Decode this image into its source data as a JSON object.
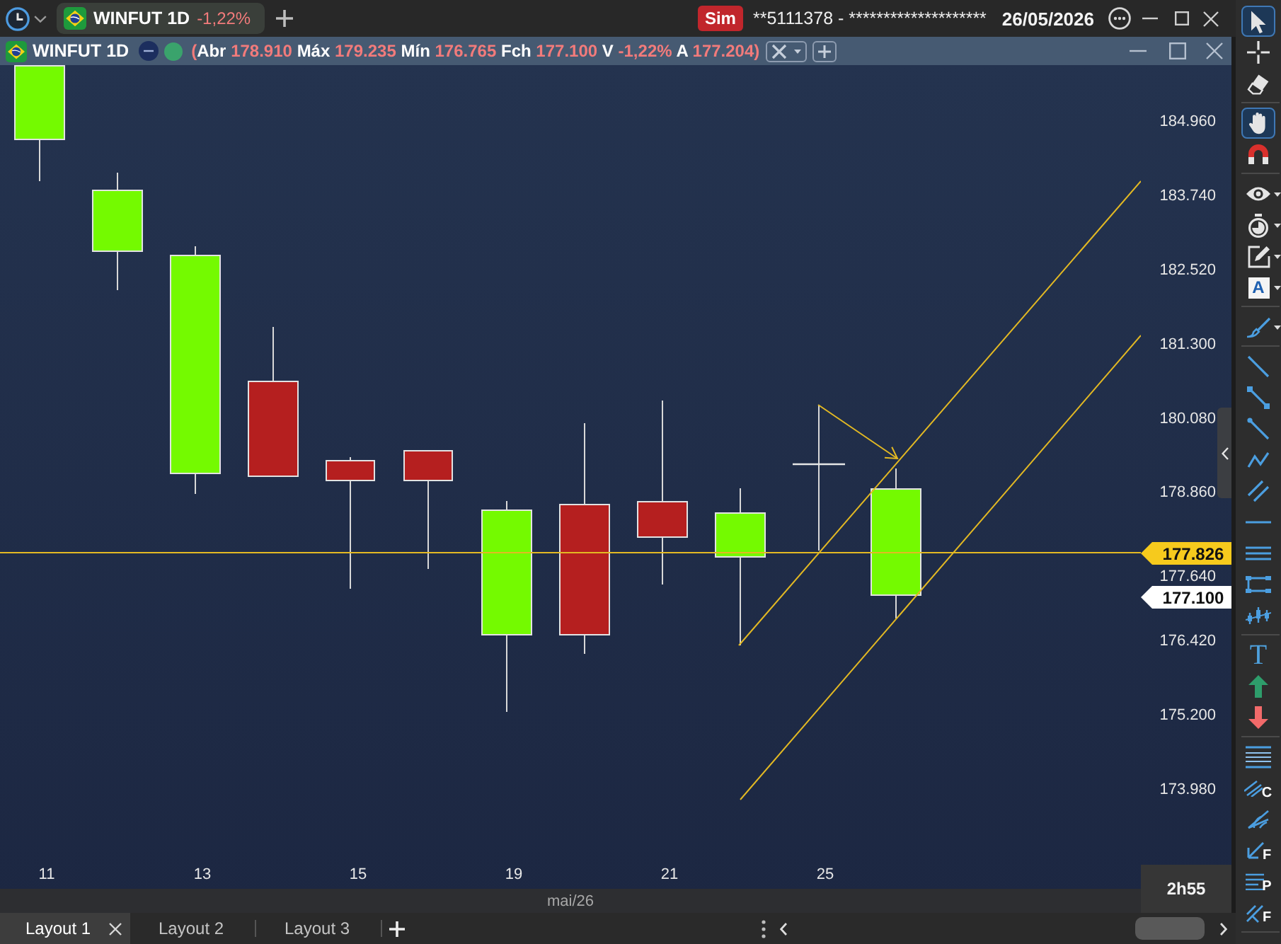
{
  "title_bar": {
    "tabs": [
      {
        "symbol": "WINFUT 1D",
        "change": "-1,22%",
        "selected": true
      }
    ],
    "mode_badge": "Sim",
    "account": "**5111378 - ********************",
    "date": "26/05/2026"
  },
  "chart": {
    "header": {
      "symbol": "WINFUT 1D",
      "quote": {
        "open": "(",
        "fields": [
          {
            "label": "Abr",
            "value": "178.910"
          },
          {
            "label": "Máx",
            "value": "179.235"
          },
          {
            "label": "Mín",
            "value": "176.765"
          },
          {
            "label": "Fch",
            "value": "177.100"
          },
          {
            "label": "V",
            "value": "-1,22%"
          },
          {
            "label": "A",
            "value": "177.204"
          }
        ],
        "close": ")"
      }
    },
    "price_axis": {
      "ticks": [
        "184.960",
        "183.740",
        "182.520",
        "181.300",
        "180.080",
        "178.860",
        "177.640",
        "176.420",
        "175.200",
        "173.980"
      ],
      "current_price": "177.826",
      "last_close": "177.100"
    },
    "time_axis": {
      "ticks": [
        "11",
        "13",
        "15",
        "19",
        "21",
        "25"
      ],
      "month": "mai/26"
    },
    "countdown": "2h55"
  },
  "layout_tabs": [
    {
      "label": "Layout 1",
      "selected": true
    },
    {
      "label": "Layout 2",
      "selected": false
    },
    {
      "label": "Layout 3",
      "selected": false
    }
  ],
  "toolbar": {
    "groups": [
      {
        "tools": [
          {
            "selected": true,
            "dropdown": false
          },
          {
            "selected": false,
            "dropdown": false
          },
          {
            "selected": false,
            "dropdown": false
          }
        ]
      },
      {
        "tools": [
          {
            "selected": true,
            "dropdown": false
          },
          {
            "selected": false,
            "dropdown": false
          }
        ]
      },
      {
        "tools": [
          {
            "selected": false,
            "dropdown": true
          },
          {
            "selected": false,
            "dropdown": true
          },
          {
            "selected": false,
            "dropdown": true
          },
          {
            "selected": false,
            "dropdown": true,
            "letter": "A"
          }
        ]
      },
      {
        "tools": [
          {
            "selected": false,
            "dropdown": true
          }
        ]
      },
      {
        "tools": [
          {
            "selected": false,
            "dropdown": false
          },
          {
            "selected": false,
            "dropdown": false
          },
          {
            "selected": false,
            "dropdown": false
          },
          {
            "selected": false,
            "dropdown": false
          },
          {
            "selected": false,
            "dropdown": false
          },
          {
            "selected": false,
            "dropdown": false
          },
          {
            "selected": false,
            "dropdown": false
          },
          {
            "selected": false,
            "dropdown": false
          },
          {
            "selected": false,
            "dropdown": false
          }
        ]
      },
      {
        "tools": [
          {
            "selected": false,
            "dropdown": false,
            "letter": "T"
          },
          {
            "selected": false,
            "dropdown": false
          },
          {
            "selected": false,
            "dropdown": false
          }
        ]
      },
      {
        "tools": [
          {
            "selected": false,
            "dropdown": false
          },
          {
            "selected": false,
            "dropdown": false,
            "letter": "C"
          },
          {
            "selected": false,
            "dropdown": false
          },
          {
            "selected": false,
            "dropdown": false,
            "letter": "F"
          },
          {
            "selected": false,
            "dropdown": false,
            "letter": "P"
          },
          {
            "selected": false,
            "dropdown": false,
            "letter": "F"
          }
        ]
      }
    ]
  }
}
